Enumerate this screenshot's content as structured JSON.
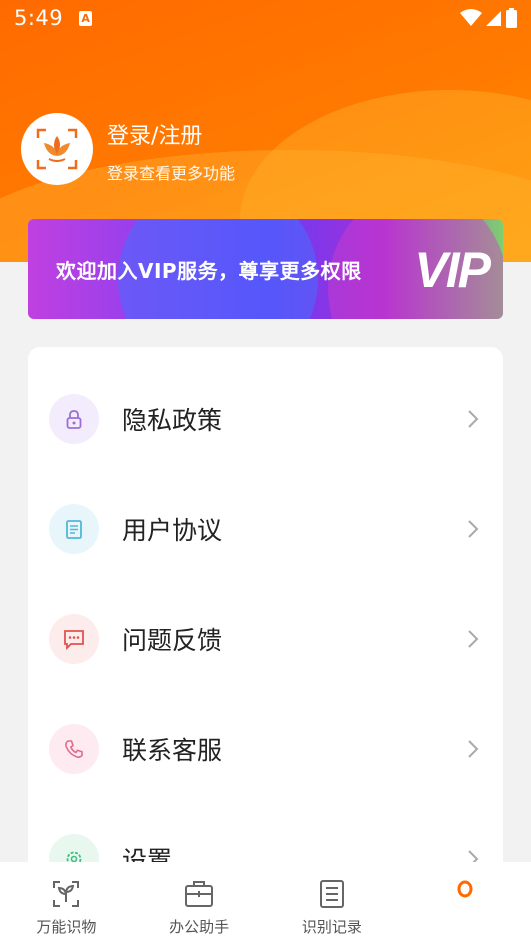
{
  "status_bar": {
    "time": "5:49",
    "notification": "A"
  },
  "profile": {
    "title": "登录/注册",
    "subtitle": "登录查看更多功能"
  },
  "vip_banner": {
    "text": "欢迎加入VIP服务，尊享更多权限",
    "logo": "VIP"
  },
  "menu": {
    "items": [
      {
        "label": "隐私政策",
        "icon": "lock-icon",
        "icon_bg": "#f3ecfc",
        "icon_color": "#9c6fd6"
      },
      {
        "label": "用户协议",
        "icon": "document-icon",
        "icon_bg": "#e8f6fb",
        "icon_color": "#4fb9d6"
      },
      {
        "label": "问题反馈",
        "icon": "message-icon",
        "icon_bg": "#fdecec",
        "icon_color": "#e0524f"
      },
      {
        "label": "联系客服",
        "icon": "phone-icon",
        "icon_bg": "#fdebf1",
        "icon_color": "#e06b8f"
      },
      {
        "label": "设置",
        "icon": "gear-icon",
        "icon_bg": "#e8f8ef",
        "icon_color": "#3fbf7f"
      }
    ]
  },
  "tabbar": {
    "tabs": [
      {
        "label": "万能识物",
        "icon": "plant-icon"
      },
      {
        "label": "办公助手",
        "icon": "briefcase-icon"
      },
      {
        "label": "识别记录",
        "icon": "list-icon"
      },
      {
        "label": "",
        "icon": "profile-icon",
        "active": true
      }
    ]
  },
  "colors": {
    "accent": "#ff6a00",
    "vip_gradient_start": "#c040e0",
    "vip_gradient_end": "#7fcf70"
  }
}
